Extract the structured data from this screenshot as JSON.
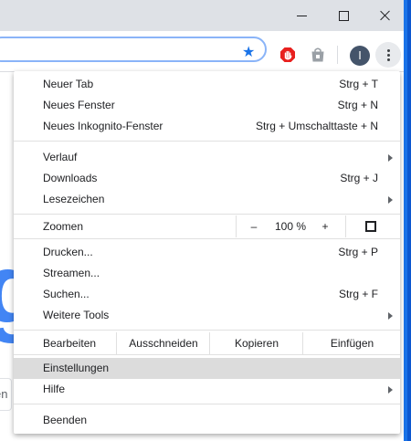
{
  "window": {
    "minimize_icon": "minimize-icon",
    "maximize_icon": "maximize-icon",
    "close_icon": "close-icon"
  },
  "toolbar": {
    "profile_initial": "I",
    "bookmark_icon": "star-icon",
    "extensions": [
      "hand-stop-icon",
      "shopping-bag-icon"
    ],
    "menu_icon": "kebab-menu-icon"
  },
  "colors": {
    "accent": "#1a73e8",
    "menu_highlight": "#dcdcdc",
    "logo_blue": "#4285f4"
  },
  "page": {
    "logo_fragment": "g",
    "search_fragment": "en"
  },
  "menu": {
    "new_tab": {
      "label": "Neuer Tab",
      "shortcut": "Strg + T"
    },
    "new_window": {
      "label": "Neues Fenster",
      "shortcut": "Strg + N"
    },
    "incognito": {
      "label": "Neues Inkognito-Fenster",
      "shortcut": "Strg + Umschalttaste + N"
    },
    "history": {
      "label": "Verlauf"
    },
    "downloads": {
      "label": "Downloads",
      "shortcut": "Strg + J"
    },
    "bookmarks": {
      "label": "Lesezeichen"
    },
    "zoom": {
      "label": "Zoomen",
      "minus": "–",
      "value": "100 %",
      "plus": "+",
      "fullscreen_icon": "fullscreen-icon"
    },
    "print": {
      "label": "Drucken...",
      "shortcut": "Strg + P"
    },
    "cast": {
      "label": "Streamen..."
    },
    "find": {
      "label": "Suchen...",
      "shortcut": "Strg + F"
    },
    "more_tools": {
      "label": "Weitere Tools"
    },
    "edit": {
      "label": "Bearbeiten",
      "cut": "Ausschneiden",
      "copy": "Kopieren",
      "paste": "Einfügen"
    },
    "settings": {
      "label": "Einstellungen"
    },
    "help": {
      "label": "Hilfe"
    },
    "exit": {
      "label": "Beenden"
    }
  }
}
